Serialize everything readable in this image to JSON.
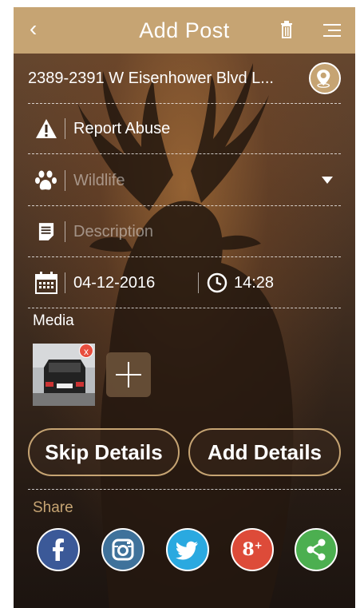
{
  "header": {
    "title": "Add Post"
  },
  "location": {
    "address": "2389-2391 W Eisenhower Blvd L..."
  },
  "form": {
    "report_label": "Report Abuse",
    "category_placeholder": "Wildlife",
    "description_placeholder": "Description",
    "date": "04-12-2016",
    "time": "14:28"
  },
  "media": {
    "label": "Media",
    "remove_glyph": "x"
  },
  "actions": {
    "skip": "Skip Details",
    "add": "Add Details"
  },
  "share": {
    "label": "Share"
  },
  "colors": {
    "accent": "#c6a473",
    "facebook": "#3b5998",
    "instagram": "#3f729b",
    "twitter": "#2aa9e0",
    "googleplus": "#dd4b39",
    "share": "#4caf50"
  }
}
